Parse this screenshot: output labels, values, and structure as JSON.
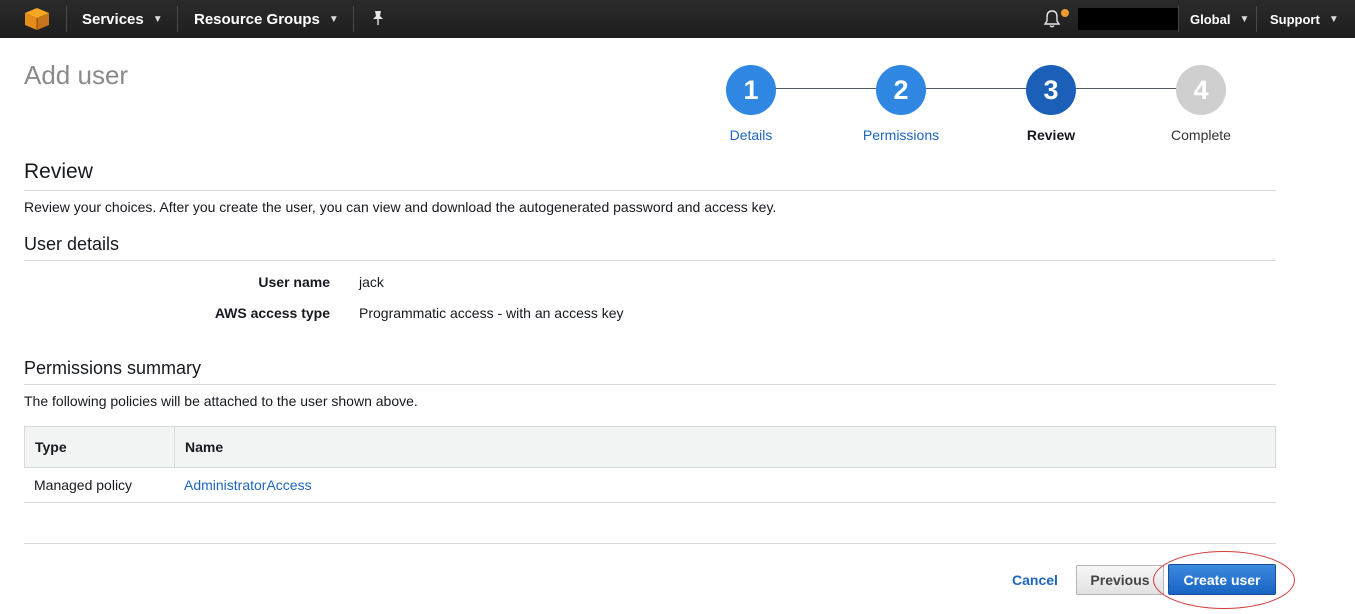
{
  "nav": {
    "services": "Services",
    "resource_groups": "Resource Groups",
    "region": "Global",
    "support": "Support"
  },
  "page": {
    "title": "Add user"
  },
  "stepper": {
    "steps": [
      {
        "number": "1",
        "label": "Details",
        "state": "done"
      },
      {
        "number": "2",
        "label": "Permissions",
        "state": "done"
      },
      {
        "number": "3",
        "label": "Review",
        "state": "current"
      },
      {
        "number": "4",
        "label": "Complete",
        "state": "pending"
      }
    ]
  },
  "review": {
    "heading": "Review",
    "description": "Review your choices. After you create the user, you can view and download the autogenerated password and access key."
  },
  "user_details": {
    "heading": "User details",
    "rows": [
      {
        "key": "User name",
        "value": "jack"
      },
      {
        "key": "AWS access type",
        "value": "Programmatic access - with an access key"
      }
    ]
  },
  "permissions": {
    "heading": "Permissions summary",
    "description": "The following policies will be attached to the user shown above.",
    "columns": [
      "Type",
      "Name"
    ],
    "rows": [
      {
        "type": "Managed policy",
        "name": "AdministratorAccess"
      }
    ]
  },
  "footer": {
    "cancel": "Cancel",
    "previous": "Previous",
    "create": "Create user"
  },
  "colors": {
    "step_done": "#2f87e2",
    "step_current": "#1b5fb8",
    "step_pending": "#cfcfcf",
    "link": "#1e65c2",
    "annotation": "#d03a3a"
  }
}
